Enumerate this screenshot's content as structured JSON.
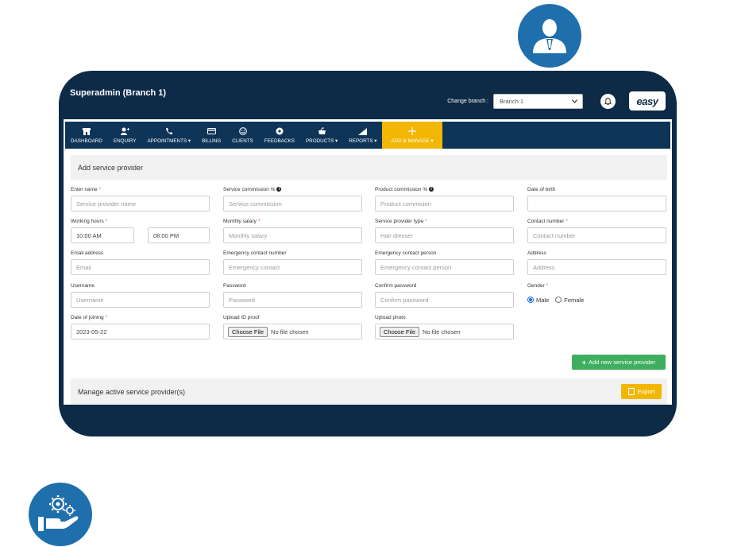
{
  "header": {
    "title": "Superadmin (Branch 1)",
    "change_branch_label": "Change branch :",
    "branch_value": "Branch 1",
    "logo_text": "easy"
  },
  "nav": [
    {
      "label": "DASHBOARD",
      "icon": "store-icon"
    },
    {
      "label": "ENQUIRY",
      "icon": "user-plus-icon"
    },
    {
      "label": "APPOINTMENTS ▾",
      "icon": "phone-icon"
    },
    {
      "label": "BILLING",
      "icon": "card-icon"
    },
    {
      "label": "CLIENTS",
      "icon": "smiley-icon"
    },
    {
      "label": "FEEDBACKS",
      "icon": "feedback-icon"
    },
    {
      "label": "PRODUCTS ▾",
      "icon": "product-icon"
    },
    {
      "label": "REPORTS ▾",
      "icon": "chart-icon"
    },
    {
      "label": "ADD & MANAGE ▾",
      "icon": "plus-icon",
      "active": true
    }
  ],
  "form": {
    "title": "Add service provider",
    "enter_name": {
      "label": "Enter name",
      "placeholder": "Service provider name"
    },
    "service_commission": {
      "label": "Service commission %",
      "placeholder": "Service commission"
    },
    "product_commission": {
      "label": "Product commission %",
      "placeholder": "Product commision"
    },
    "date_of_birth": {
      "label": "Date of birth",
      "placeholder": ""
    },
    "working_hours": {
      "label": "Working hours",
      "start": "10:00 AM",
      "end": "08:00 PM"
    },
    "monthly_salary": {
      "label": "Monthly salary",
      "placeholder": "Monthly salary"
    },
    "service_provider_type": {
      "label": "Service provider type",
      "placeholder": "Hair dresser"
    },
    "contact_number": {
      "label": "Contact number",
      "placeholder": "Contact number"
    },
    "email": {
      "label": "Email address",
      "placeholder": "Email"
    },
    "emergency_number": {
      "label": "Emergency contact number",
      "placeholder": "Emergency contact"
    },
    "emergency_person": {
      "label": "Emergency contact person",
      "placeholder": "Emergency contact person"
    },
    "address": {
      "label": "Address",
      "placeholder": "Address"
    },
    "username": {
      "label": "Username",
      "placeholder": "Username"
    },
    "password": {
      "label": "Password",
      "placeholder": "Password"
    },
    "confirm_password": {
      "label": "Confirm password",
      "placeholder": "Confirm password"
    },
    "gender": {
      "label": "Gender",
      "options": [
        "Male",
        "Female"
      ],
      "selected": "Male"
    },
    "date_of_joining": {
      "label": "Date of joining",
      "value": "2023-05-22"
    },
    "upload_id": {
      "label": "Upload ID proof",
      "button": "Choose File",
      "status": "No file chosen"
    },
    "upload_photo": {
      "label": "Upload photo",
      "button": "Choose File",
      "status": "No file chosen"
    },
    "required_mark": "*",
    "info_mark": "i",
    "add_button": "Add new service provider",
    "add_button_plus": "+"
  },
  "manage": {
    "title": "Manage active service provider(s)",
    "export_button": "Export"
  },
  "colors": {
    "navy": "#0e3457",
    "frame": "#0d2a47",
    "accent": "#f2b705",
    "success": "#3fae5e",
    "badge": "#1f6fad"
  }
}
